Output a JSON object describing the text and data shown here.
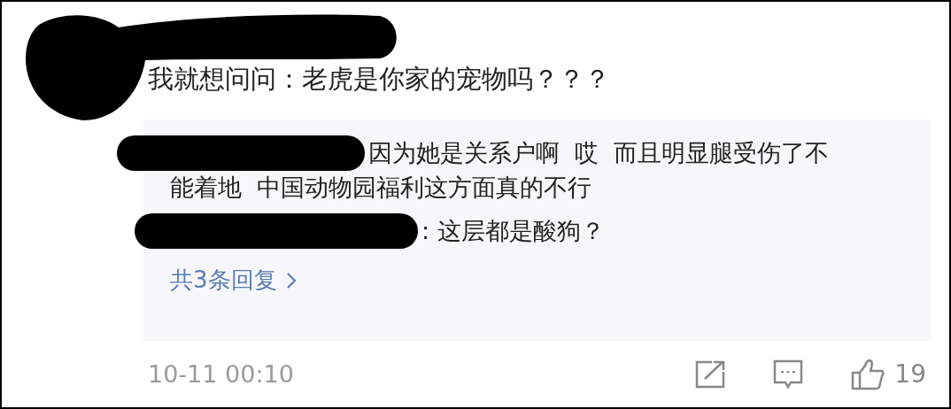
{
  "comment": {
    "text": "我就想问问：老虎是你家的宠物吗？？？"
  },
  "replies": [
    {
      "lines": [
        "因为她是关系户啊  哎  而且明显腿受伤了不",
        "能着地  中国动物园福利这方面真的不行"
      ]
    },
    {
      "lines": [
        ": 这层都是酸狗？"
      ]
    }
  ],
  "more_replies": "共3条回复",
  "footer": {
    "time": "10-11 00:10",
    "like_count": "19"
  }
}
